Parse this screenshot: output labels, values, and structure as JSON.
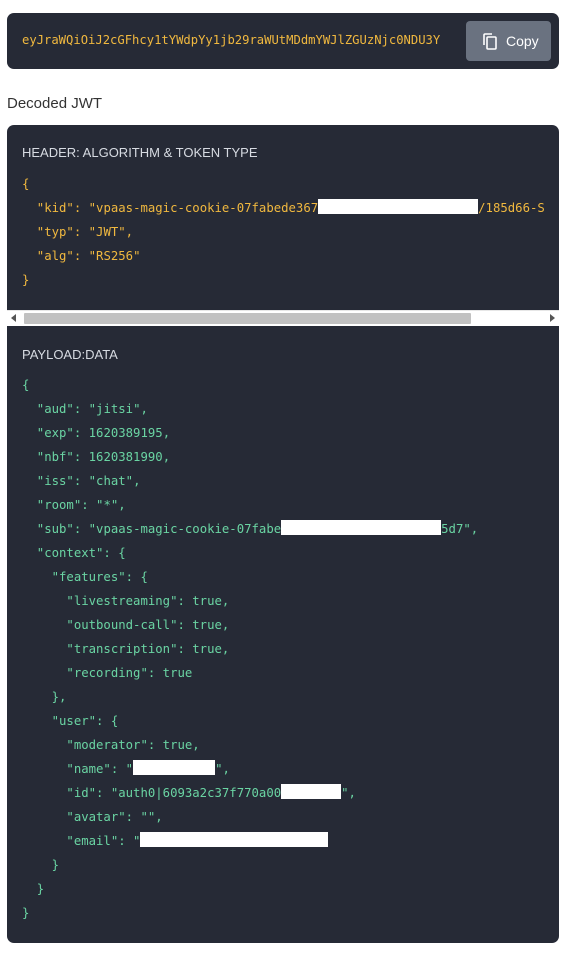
{
  "token": {
    "text": "eyJraWQiOiJ2cGFhcy1tYWdpYy1jb29raWUtMDdmYWJlZGUzNjc0NDU3Y",
    "copy_label": "Copy"
  },
  "section_label": "Decoded JWT",
  "header_panel": {
    "title": "HEADER: ALGORITHM & TOKEN TYPE",
    "kid_prefix": "vpaas-magic-cookie-07fabede367",
    "kid_suffix": "/185d66-S",
    "typ": "JWT",
    "alg": "RS256"
  },
  "payload_panel": {
    "title": "PAYLOAD:DATA",
    "aud": "jitsi",
    "exp": "1620389195",
    "nbf": "1620381990",
    "iss": "chat",
    "room": "*",
    "sub_prefix": "vpaas-magic-cookie-07fabe",
    "sub_suffix": "5d7",
    "features": {
      "livestreaming": "true",
      "outbound_call": "true",
      "transcription": "true",
      "recording": "true"
    },
    "user": {
      "moderator": "true",
      "id_prefix": "auth0|6093a2c37f770a00",
      "avatar": ""
    }
  },
  "colors": {
    "panel_bg": "#262a36",
    "header_code": "#f0b83f",
    "payload_code": "#6ad4a3",
    "copy_button": "#6a7280"
  },
  "icons": {
    "copy": "copy-icon"
  }
}
